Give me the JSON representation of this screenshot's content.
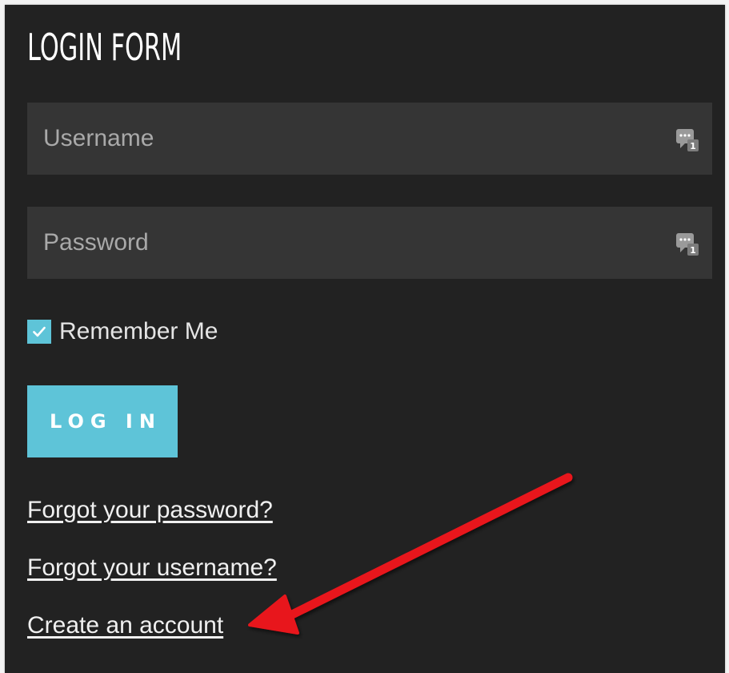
{
  "form": {
    "title": "LOGIN FORM",
    "username": {
      "placeholder": "Username",
      "value": ""
    },
    "password": {
      "placeholder": "Password",
      "value": ""
    },
    "remember_me": {
      "label": "Remember Me",
      "checked": true
    },
    "login_button": "LOG IN",
    "links": {
      "forgot_password": "Forgot your password?",
      "forgot_username": "Forgot your username?",
      "create_account": "Create an account"
    }
  },
  "icons": {
    "field_icon": "password-manager-key-icon",
    "checkbox": "checkmark-icon",
    "annotation": "red-arrow-icon"
  },
  "colors": {
    "panel_background": "#222222",
    "field_background": "#353535",
    "accent": "#5ec4d8",
    "annotation_arrow": "#e8151b"
  }
}
